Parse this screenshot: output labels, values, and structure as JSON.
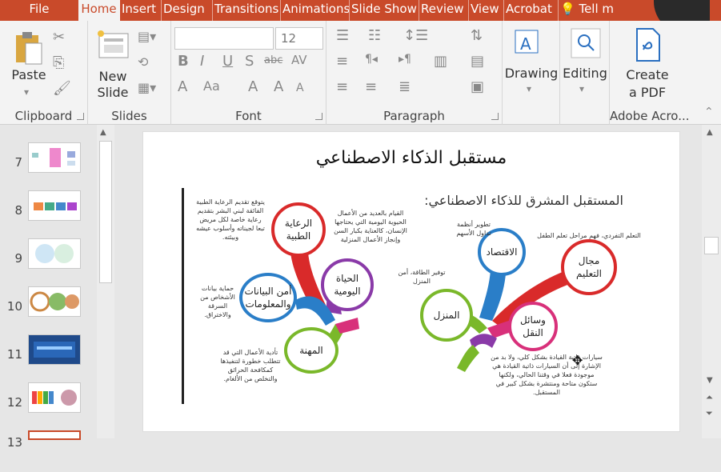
{
  "tabs": {
    "file": "File",
    "home": "Home",
    "insert": "Insert",
    "design": "Design",
    "transitions": "Transitions",
    "animations": "Animations",
    "slideshow": "Slide Show",
    "review": "Review",
    "view": "View",
    "acrobat": "Acrobat",
    "tellme": "Tell m"
  },
  "ribbon": {
    "clipboard": {
      "label": "Clipboard",
      "paste": "Paste"
    },
    "slides": {
      "label": "Slides",
      "new_slide_1": "New",
      "new_slide_2": "Slide"
    },
    "font": {
      "label": "Font",
      "font_name": "",
      "font_size": "12"
    },
    "paragraph": {
      "label": "Paragraph"
    },
    "drawing": {
      "label": "Drawing"
    },
    "editing": {
      "label": "Editing"
    },
    "adobe": {
      "label": "Adobe Acro...",
      "create_1": "Create",
      "create_2": "a PDF"
    }
  },
  "thumbnails": [
    "7",
    "8",
    "9",
    "10",
    "11",
    "12",
    "13"
  ],
  "slide": {
    "title": "مستقبل الذكاء الاصطناعي",
    "subtitle": "المستقبل المشرق للذكاء الاصطناعي:",
    "left_nodes": {
      "medical": "الرعاية الطبية",
      "daily": "الحياة اليومية",
      "security": "أمن البيانات والمعلومات",
      "career": "المهنة"
    },
    "right_nodes": {
      "economy": "الاقتصاد",
      "education": "مجال التعليم",
      "home": "المنزل",
      "transport": "وسائل النقل"
    },
    "notes": {
      "medical": "يتوقع تقديم الرعاية الطبية الفائقة لبني البشر بتقديم رعاية خاصة لكل مريض تبعا لجيناته وأسلوب عيشه وبيئته.",
      "daily": "القيام بالعديد من الأعمال الحيوية اليومية التي يحتاجها الإنسان، كالعناية بكبار السن وإنجاز الأعمال المنزلية",
      "security": "حماية بيانات الأشخاص من السرقة والاختراق.",
      "career": "تأدية الأعمال التي قد تتطلب خطورة لتنفيذها كمكافحة الحرائق والتخلص من الألغام.",
      "economy": "تطوير أنظمة تداول الأسهم",
      "education": "التعلم التفردي، فهم مراحل تعلم الطفل",
      "home": "توفير الطاقة، أمن المنزل",
      "transport": "سيارات ذاتية القيادة بشكل كلي، ولا بد من الإشارة إلى أن السيارات ذاتية القيادة هي موجودة فعلا في وقتنا الحالي، ولكنها ستكون متاحة ومنتشرة بشكل كبير في المستقبل."
    }
  },
  "colors": {
    "accent": "#c94a2a",
    "red": "#d92a2a",
    "purple": "#8a3aa8",
    "blue": "#2a7ec8",
    "green": "#7ab82a",
    "pink": "#d8307a",
    "orange": "#f0a020"
  }
}
